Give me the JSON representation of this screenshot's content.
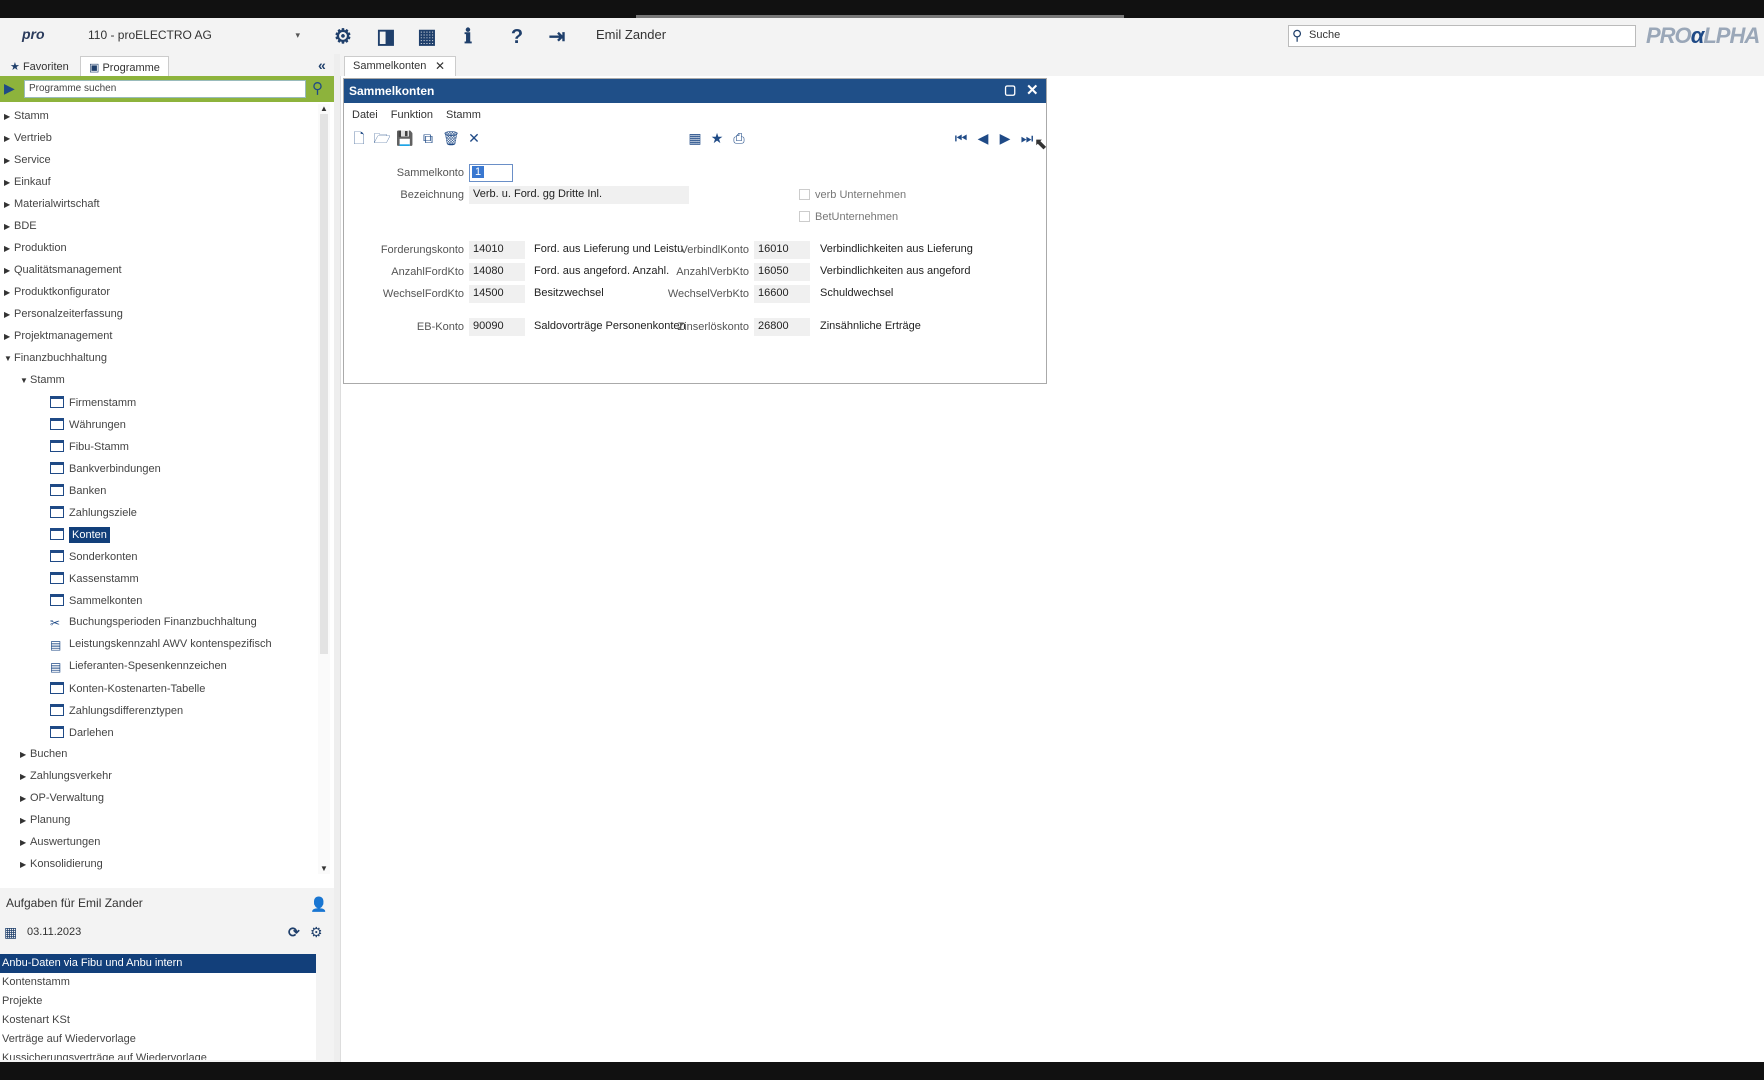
{
  "header": {
    "logo": "pro",
    "company": "110 - proELECTRO AG",
    "user": "Emil Zander",
    "search_placeholder": "Suche",
    "brand_left": "PRO",
    "brand_mid": "α",
    "brand_right": "LPHA"
  },
  "left_tabs": {
    "favorites": "Favoriten",
    "programs": "Programme"
  },
  "program_search": {
    "placeholder": "Programme suchen"
  },
  "tree": {
    "top": [
      "Stamm",
      "Vertrieb",
      "Service",
      "Einkauf",
      "Materialwirtschaft",
      "BDE",
      "Produktion",
      "Qualitätsmanagement",
      "Produktkonfigurator",
      "Personalzeiterfassung",
      "Projektmanagement",
      "Finanzbuchhaltung"
    ],
    "stamm_group": "Stamm",
    "stamm_items": [
      "Firmenstamm",
      "Währungen",
      "Fibu-Stamm",
      "Bankverbindungen",
      "Banken",
      "Zahlungsziele",
      "Konten",
      "Sonderkonten",
      "Kassenstamm",
      "Sammelkonten",
      "Buchungsperioden Finanzbuchhaltung",
      "Leistungskennzahl AWV kontenspezifisch",
      "Lieferanten-Spesenkennzeichen",
      "Konten-Kostenarten-Tabelle",
      "Zahlungsdifferenztypen",
      "Darlehen"
    ],
    "sub_groups": [
      "Buchen",
      "Zahlungsverkehr",
      "OP-Verwaltung",
      "Planung",
      "Auswertungen",
      "Konsolidierung"
    ]
  },
  "tasks": {
    "title": "Aufgaben für Emil Zander",
    "date": "03.11.2023",
    "items": [
      "Anbu-Daten via Fibu und Anbu intern",
      "Kontenstamm",
      "Projekte",
      "Kostenart KSt",
      "Verträge auf Wiedervorlage",
      "Kussicherungsverträge auf Wiedervorlage"
    ]
  },
  "doc_tab": {
    "label": "Sammelkonten"
  },
  "window": {
    "title": "Sammelkonten",
    "menu": [
      "Datei",
      "Funktion",
      "Stamm"
    ],
    "fields": {
      "sammelkonto_label": "Sammelkonto",
      "sammelkonto_value": "1",
      "bezeichnung_label": "Bezeichnung",
      "bezeichnung_value": "Verb. u. Ford. gg Dritte Inl.",
      "verb_unternehmen": "verb Unternehmen",
      "bet_unternehmen": "BetUnternehmen",
      "left_rows": [
        {
          "label": "Forderungskonto",
          "num": "14010",
          "text": "Ford. aus Lieferung und Leistu"
        },
        {
          "label": "AnzahlFordKto",
          "num": "14080",
          "text": "Ford. aus angeford. Anzahl."
        },
        {
          "label": "WechselFordKto",
          "num": "14500",
          "text": "Besitzwechsel"
        },
        {
          "label": "EB-Konto",
          "num": "90090",
          "text": "Saldovorträge Personenkonten"
        }
      ],
      "right_rows": [
        {
          "label": "VerbindlKonto",
          "num": "16010",
          "text": "Verbindlichkeiten aus Lieferung"
        },
        {
          "label": "AnzahlVerbKto",
          "num": "16050",
          "text": "Verbindlichkeiten aus angeford"
        },
        {
          "label": "WechselVerbKto",
          "num": "16600",
          "text": "Schuldwechsel"
        },
        {
          "label": "Zinserlöskonto",
          "num": "26800",
          "text": "Zinsähnliche Erträge"
        }
      ]
    }
  },
  "colors": {
    "accent": "#1f4f88",
    "selection": "#123f7a",
    "search_bar": "#8db33c"
  }
}
